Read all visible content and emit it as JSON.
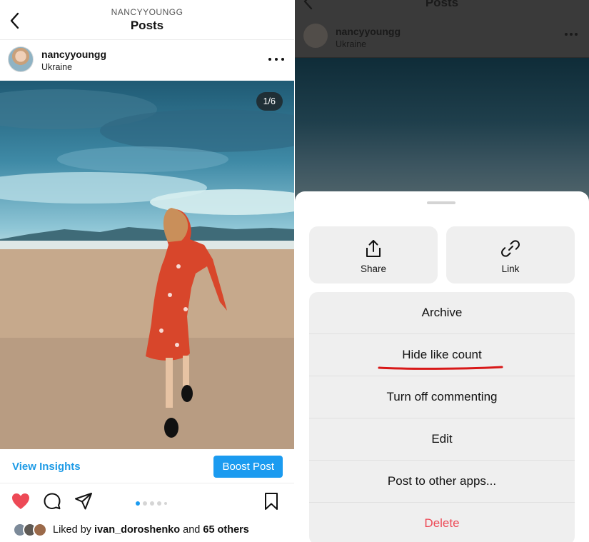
{
  "left": {
    "header": {
      "username": "NANCYYOUNGG",
      "title": "Posts"
    },
    "post": {
      "username": "nancyyoungg",
      "location": "Ukraine",
      "image_counter": "1/6",
      "carousel": {
        "total": 5,
        "active_index": 0
      }
    },
    "actions": {
      "insights_label": "View Insights",
      "boost_label": "Boost Post"
    },
    "likes": {
      "prefix": "Liked by",
      "user": "ivan_doroshenko",
      "connector": "and",
      "others": "65 others"
    }
  },
  "right": {
    "header": {
      "title": "Posts",
      "username": "nancyyoungg",
      "location": "Ukraine"
    },
    "sheet": {
      "tiles": [
        {
          "label": "Share",
          "icon": "share-icon"
        },
        {
          "label": "Link",
          "icon": "link-icon"
        }
      ],
      "menu": [
        {
          "label": "Archive"
        },
        {
          "label": "Hide like count",
          "highlighted": true
        },
        {
          "label": "Turn off commenting"
        },
        {
          "label": "Edit"
        },
        {
          "label": "Post to other apps..."
        },
        {
          "label": "Delete",
          "destructive": true
        }
      ]
    }
  },
  "colors": {
    "accent_blue": "#1b9bf0",
    "like_red": "#ed4956",
    "delete_red": "#ed4956",
    "highlight_underline": "#d81818"
  }
}
